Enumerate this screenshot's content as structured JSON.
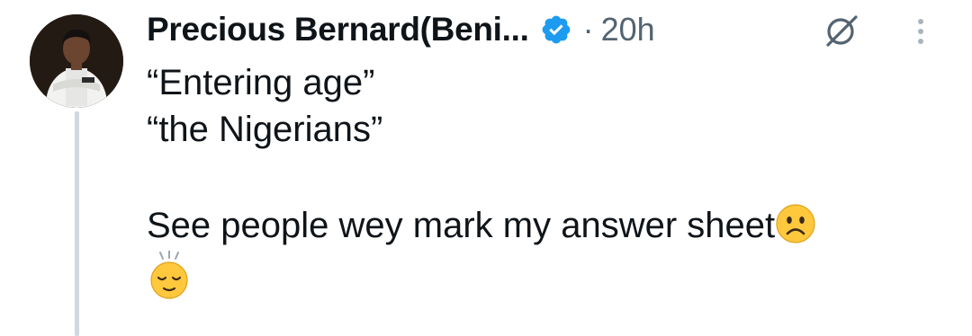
{
  "tweet": {
    "author": {
      "display_name": "Precious Bernard(Beni...",
      "verified": true,
      "avatar": "person-avatar"
    },
    "separator": "·",
    "timestamp": "20h",
    "text_lines": [
      "“Entering age”",
      "“the Nigerians”",
      "",
      "See people wey mark my answer sheet"
    ],
    "emojis": [
      "frowning-face-emoji",
      "relieved-face-emoji"
    ]
  },
  "icons": {
    "verified": "verified-badge-icon",
    "grok": "grok-icon",
    "more": "more-vertical-icon"
  },
  "colors": {
    "text": "#0f1419",
    "muted": "#536471",
    "verified_blue": "#1d9bf0",
    "thread_line": "#cfd9de"
  }
}
